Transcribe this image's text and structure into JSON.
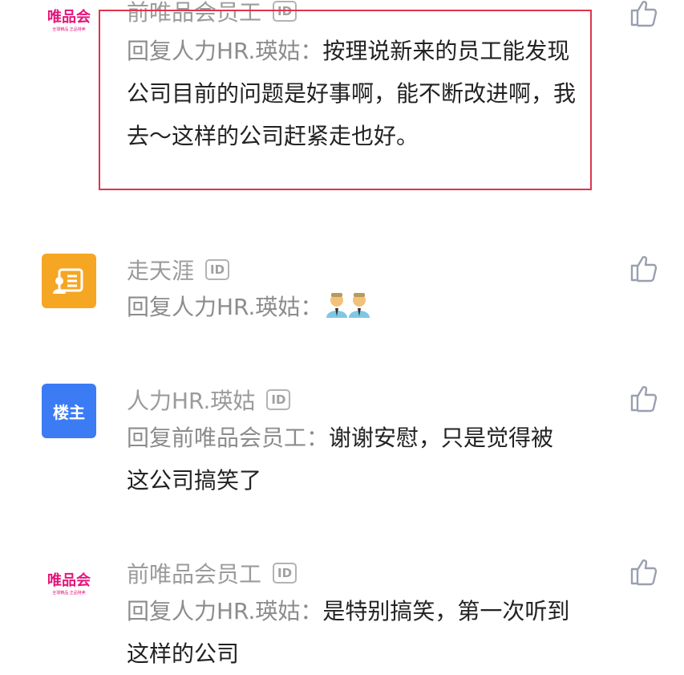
{
  "comments": [
    {
      "avatar": {
        "type": "vip",
        "text": "唯品会",
        "subtext": "全球精品 正品特卖"
      },
      "name": "前唯品会员工",
      "id_badge": "ID",
      "reply_prefix": "回复人力HR.瑛姑：",
      "text": "按理说新来的员工能发现公司目前的问题是好事啊，能不断改进啊，我去～这样的公司赶紧走也好。",
      "highlighted": true
    },
    {
      "avatar": {
        "type": "orange",
        "icon": "id-card-icon"
      },
      "name": "走天涯",
      "id_badge": "ID",
      "reply_prefix": "回复人力HR.瑛姑：",
      "text": "",
      "emoji": "handshake-emoji"
    },
    {
      "avatar": {
        "type": "blue",
        "text": "楼主"
      },
      "name": "人力HR.瑛姑",
      "id_badge": "ID",
      "reply_prefix": "回复前唯品会员工：",
      "text": "谢谢安慰，只是觉得被这公司搞笑了"
    },
    {
      "avatar": {
        "type": "vip",
        "text": "唯品会",
        "subtext": "全球精品 正品特卖"
      },
      "name": "前唯品会员工",
      "id_badge": "ID",
      "reply_prefix": "回复人力HR.瑛姑：",
      "text": "是特别搞笑，第一次听到这样的公司"
    }
  ],
  "colors": {
    "highlight_border": "#e0344b",
    "vip_pink": "#e6157a",
    "orange_avatar": "#f5a623",
    "blue_avatar": "#3b7cf5"
  }
}
